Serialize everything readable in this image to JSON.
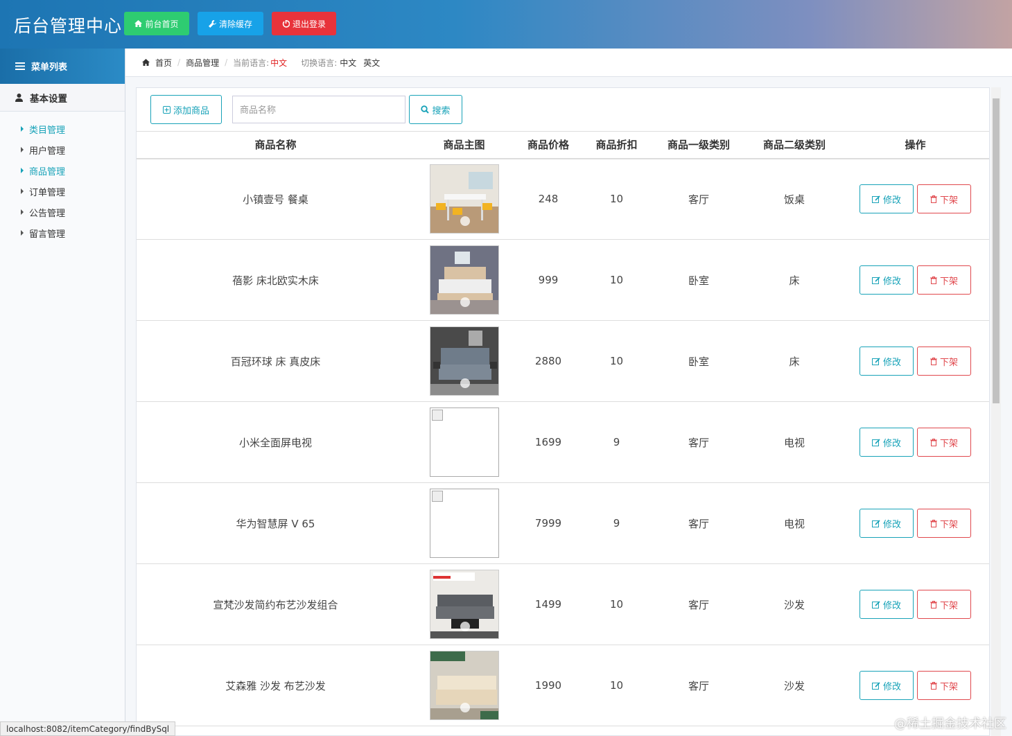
{
  "header": {
    "title": "后台管理中心",
    "buttons": [
      {
        "label": "前台首页",
        "icon": "home-icon",
        "color": "#2ecc71"
      },
      {
        "label": "清除缓存",
        "icon": "wrench-icon",
        "color": "#17a2e8"
      },
      {
        "label": "退出登录",
        "icon": "power-icon",
        "color": "#e8333b"
      }
    ]
  },
  "sidebar": {
    "menu_title": "菜单列表",
    "group": "基本设置",
    "items": [
      {
        "label": "类目管理",
        "active": true
      },
      {
        "label": "用户管理",
        "active": false
      },
      {
        "label": "商品管理",
        "active": true
      },
      {
        "label": "订单管理",
        "active": false
      },
      {
        "label": "公告管理",
        "active": false
      },
      {
        "label": "留言管理",
        "active": false
      }
    ]
  },
  "breadcrumb": {
    "home": "首页",
    "current": "商品管理",
    "lang_label": "当前语言:",
    "lang_value": "中文",
    "switch_label": "切换语言:",
    "opt_zh": "中文",
    "opt_en": "英文"
  },
  "toolbar": {
    "add_label": "添加商品",
    "search_placeholder": "商品名称",
    "search_label": "搜索"
  },
  "table": {
    "headers": [
      "商品名称",
      "商品主图",
      "商品价格",
      "商品折扣",
      "商品一级类别",
      "商品二级类别",
      "操作"
    ],
    "edit_label": "修改",
    "delete_label": "下架",
    "rows": [
      {
        "name": "小镇壹号 餐桌",
        "price": "248",
        "discount": "10",
        "cat1": "客厅",
        "cat2": "饭桌",
        "image": "dining-table"
      },
      {
        "name": "蓓影 床北欧实木床",
        "price": "999",
        "discount": "10",
        "cat1": "卧室",
        "cat2": "床",
        "image": "wood-bed"
      },
      {
        "name": "百冠环球 床 真皮床",
        "price": "2880",
        "discount": "10",
        "cat1": "卧室",
        "cat2": "床",
        "image": "leather-bed"
      },
      {
        "name": "小米全面屏电视",
        "price": "1699",
        "discount": "9",
        "cat1": "客厅",
        "cat2": "电视",
        "image": "broken"
      },
      {
        "name": "华为智慧屏 V 65",
        "price": "7999",
        "discount": "9",
        "cat1": "客厅",
        "cat2": "电视",
        "image": "broken"
      },
      {
        "name": "宣梵沙发简约布艺沙发组合",
        "price": "1499",
        "discount": "10",
        "cat1": "客厅",
        "cat2": "沙发",
        "image": "gray-sofa"
      },
      {
        "name": "艾森雅 沙发 布艺沙发",
        "price": "1990",
        "discount": "10",
        "cat1": "客厅",
        "cat2": "沙发",
        "image": "beige-sofa"
      }
    ]
  },
  "statusbar": {
    "url": "localhost:8082/itemCategory/findBySql"
  },
  "watermark": "@稀土掘金技术社区"
}
